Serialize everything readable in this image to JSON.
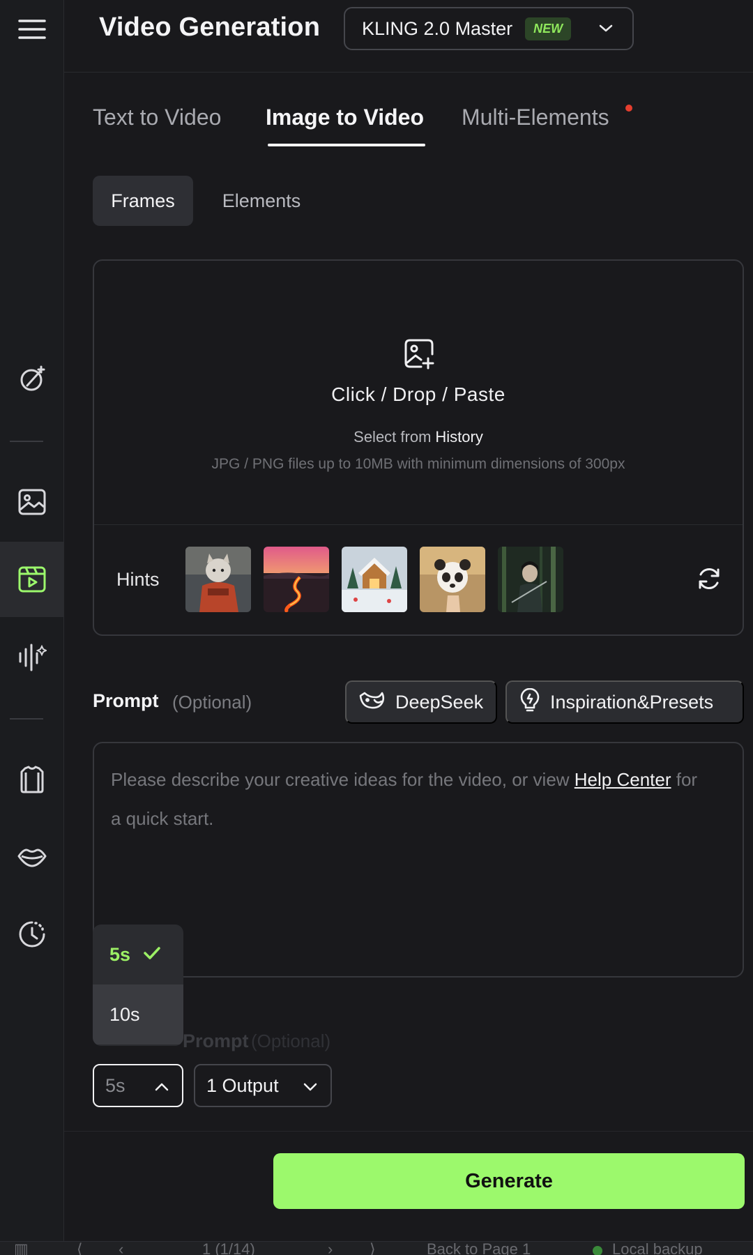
{
  "header": {
    "title": "Video Generation",
    "model": {
      "name": "KLING 2.0 Master",
      "badge": "NEW"
    }
  },
  "tabs": [
    {
      "label": "Text to Video"
    },
    {
      "label": "Image to Video"
    },
    {
      "label": "Multi-Elements"
    }
  ],
  "subtabs": [
    {
      "label": "Frames"
    },
    {
      "label": "Elements"
    }
  ],
  "upload": {
    "main": "Click / Drop / Paste",
    "select_prefix": "Select from",
    "history": "History",
    "note": "JPG / PNG files up to 10MB with minimum dimensions of 300px",
    "hints_label": "Hints"
  },
  "prompt": {
    "label": "Prompt",
    "optional": "(Optional)",
    "deepseek": "DeepSeek",
    "inspiration": "Inspiration&Presets",
    "placeholder_start": "Please describe your creative ideas for the video, or view ",
    "help_link": "Help Center",
    "placeholder_end": " for a quick start."
  },
  "ghost": {
    "label": "Prompt",
    "optional": "(Optional)"
  },
  "duration_menu": {
    "options": [
      {
        "label": "5s",
        "selected": true
      },
      {
        "label": "10s",
        "selected": false
      }
    ]
  },
  "controls": {
    "duration": "5s",
    "outputs": "1 Output"
  },
  "generate_label": "Generate",
  "pagebar": {
    "page": "1 (1/14)",
    "back": "Back to Page 1",
    "backup": "Local backup"
  },
  "colors": {
    "accent": "#9cf96c",
    "background": "#19191c",
    "badge_bg": "#2c4527",
    "notification": "#e53e2e"
  },
  "icons": {
    "menu": "hamburger-menu-icon",
    "magic": "magic-wand-icon",
    "image": "image-icon",
    "video": "video-icon",
    "audio": "audio-waveform-icon",
    "tryon": "shirt-icon",
    "lips": "lips-icon",
    "history": "history-clock-icon"
  }
}
